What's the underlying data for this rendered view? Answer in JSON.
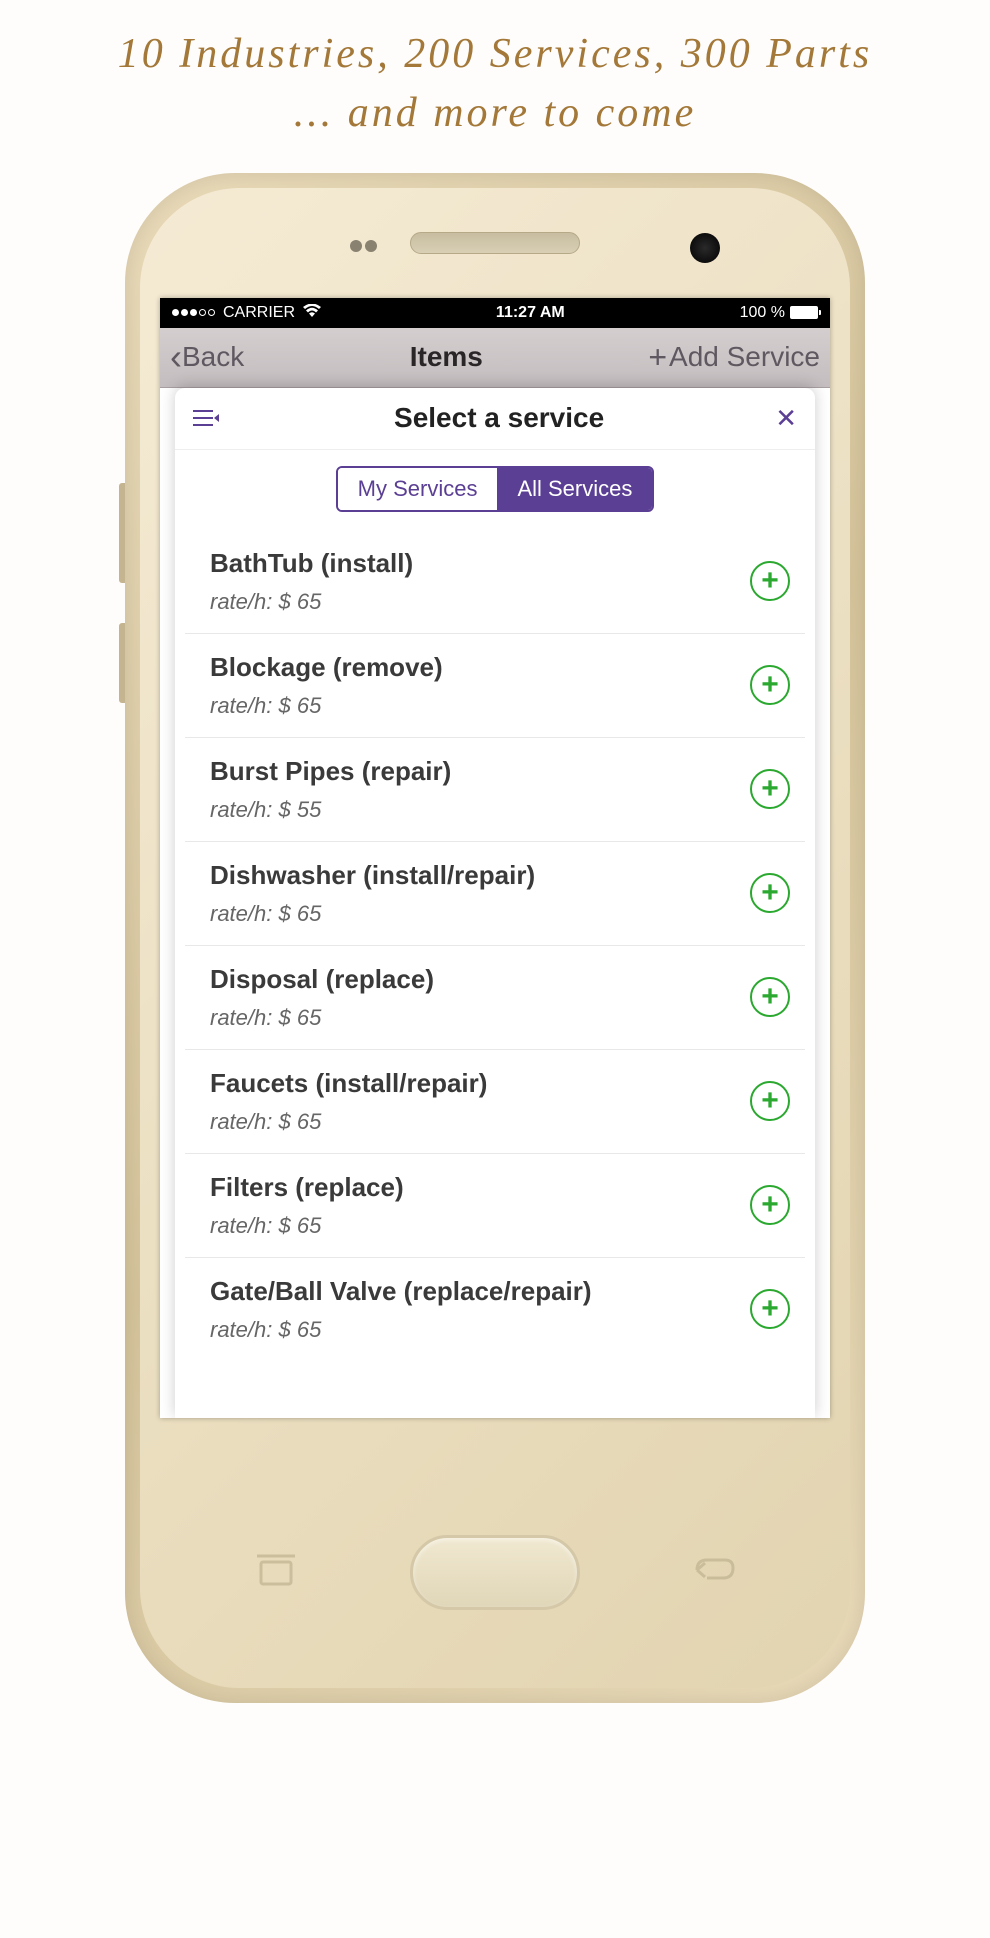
{
  "marketing": {
    "line1": "10 Industries, 200 Services, 300 Parts",
    "line2": "... and more to come"
  },
  "status_bar": {
    "carrier": "CARRIER",
    "time": "11:27 AM",
    "battery": "100 %"
  },
  "nav": {
    "back": "Back",
    "title": "Items",
    "add": "Add Service"
  },
  "modal": {
    "title": "Select a service",
    "segment": {
      "my": "My Services",
      "all": "All Services"
    }
  },
  "rate_prefix": "rate/h: $ ",
  "services": [
    {
      "name": "BathTub (install)",
      "rate": "65"
    },
    {
      "name": "Blockage (remove)",
      "rate": "65"
    },
    {
      "name": "Burst Pipes (repair)",
      "rate": "55"
    },
    {
      "name": "Dishwasher (install/repair)",
      "rate": "65"
    },
    {
      "name": "Disposal (replace)",
      "rate": "65"
    },
    {
      "name": "Faucets (install/repair)",
      "rate": "65"
    },
    {
      "name": "Filters (replace)",
      "rate": "65"
    },
    {
      "name": "Gate/Ball Valve (replace/repair)",
      "rate": "65"
    }
  ]
}
